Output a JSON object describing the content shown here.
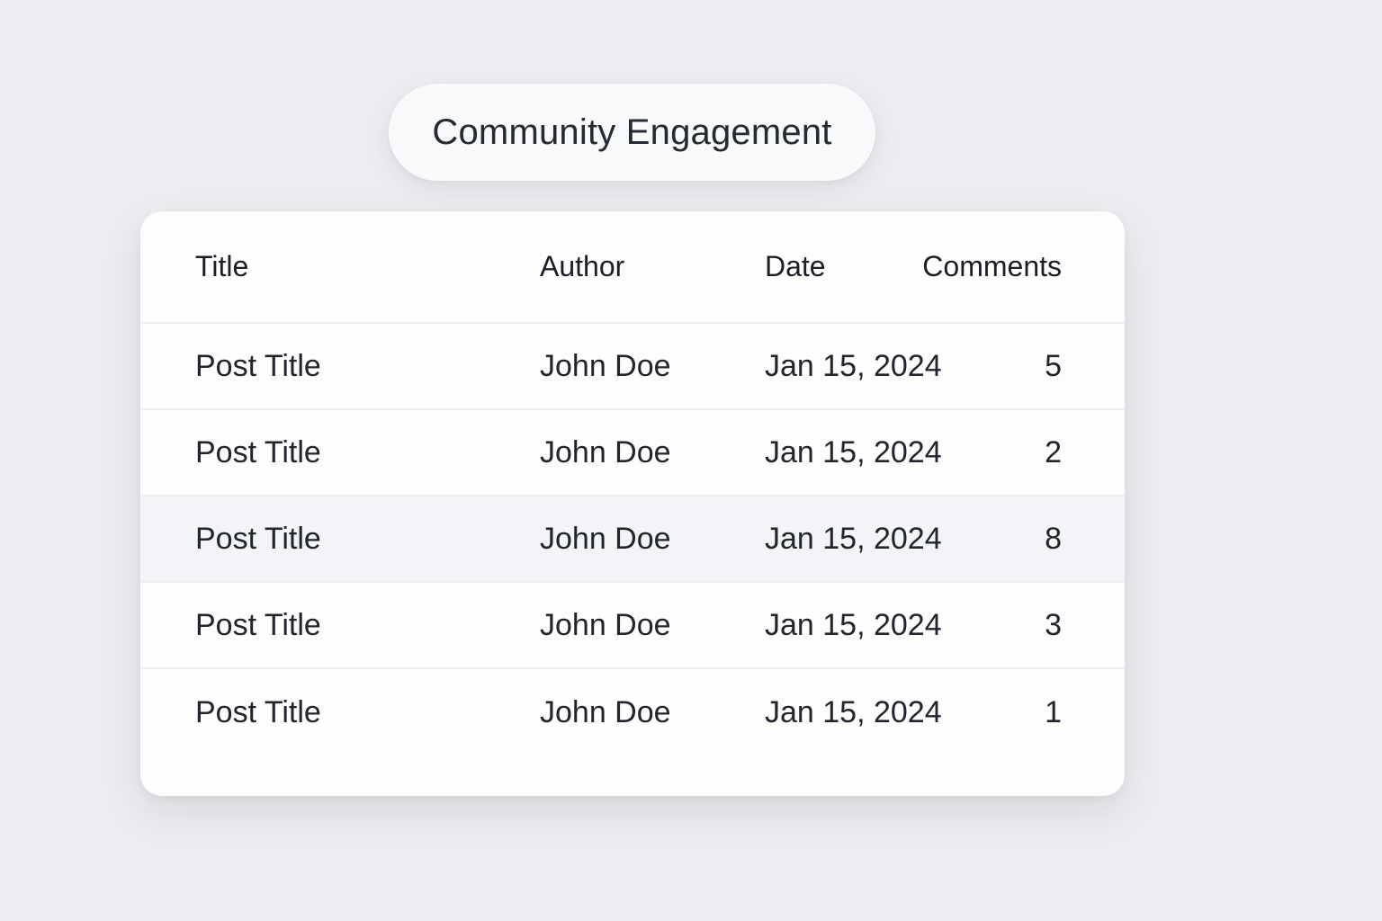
{
  "page": {
    "title": "Community Engagement"
  },
  "table": {
    "columns": {
      "title": "Title",
      "author": "Author",
      "date": "Date",
      "comments": "Comments"
    },
    "rows": [
      {
        "title": "Post Title",
        "author": "John Doe",
        "date": "Jan 15, 2024",
        "comments": "5"
      },
      {
        "title": "Post Title",
        "author": "John Doe",
        "date": "Jan 15, 2024",
        "comments": "2"
      },
      {
        "title": "Post Title",
        "author": "John Doe",
        "date": "Jan 15, 2024",
        "comments": "8"
      },
      {
        "title": "Post Title",
        "author": "John Doe",
        "date": "Jan 15, 2024",
        "comments": "3"
      },
      {
        "title": "Post Title",
        "author": "John Doe",
        "date": "Jan 15, 2024",
        "comments": "1"
      }
    ],
    "highlighted_row_index": 2
  },
  "colors": {
    "background": "#ecedf0",
    "card": "#fdfdfe",
    "highlight_row": "#f3f4f7",
    "divider": "#eceef2",
    "text": "#22252e"
  }
}
